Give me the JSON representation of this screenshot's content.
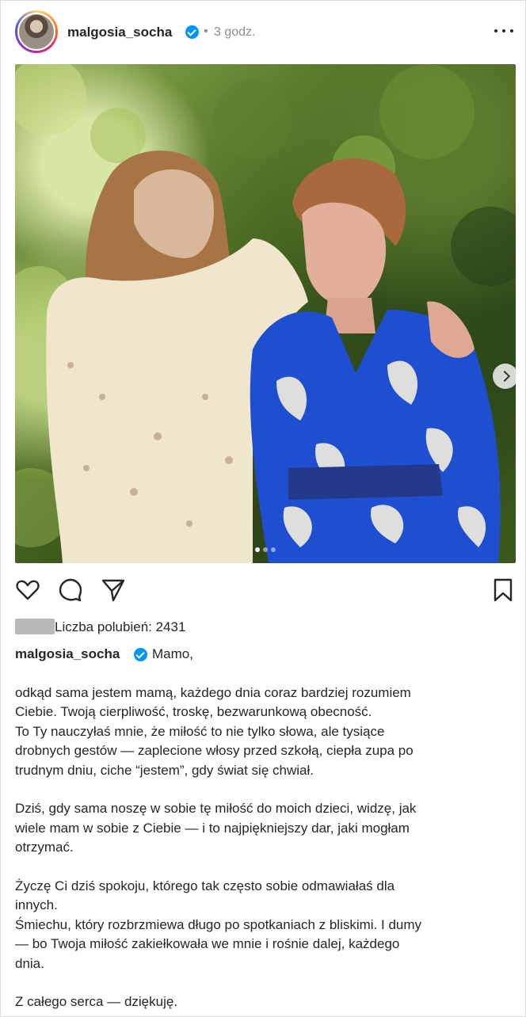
{
  "post": {
    "username": "malgosia_socha",
    "time": "3 godz.",
    "separator": "•",
    "likes_text": "Liczba polubień: 2431",
    "caption_first": "Mamo,",
    "caption_paragraphs": [
      [
        "odkąd sama jestem mamą, każdego dnia coraz bardziej rozumiem",
        "Ciebie. Twoją cierpliwość, troskę, bezwarunkową obecność.",
        "To Ty nauczyłaś mnie, że miłość to nie tylko słowa, ale tysiące",
        "drobnych gestów — zaplecione włosy przed szkołą, ciepła zupa po",
        "trudnym dniu, ciche “jestem”, gdy świat się chwiał."
      ],
      [
        "Dziś, gdy sama noszę w sobie tę miłość do moich dzieci, widzę, jak",
        "wiele mam w sobie z Ciebie — i to najpiękniejszy dar, jaki mogłam",
        "otrzymać."
      ],
      [
        "Życzę Ci dziś spokoju, którego tak często sobie odmawiałaś dla",
        "innych.",
        "Śmiechu, który rozbrzmiewa długo po spotkaniach z bliskimi. I dumy",
        "— bo Twoja miłość zakiełkowała we mnie i rośnie dalej, każdego",
        "dnia."
      ],
      [
        "Z całego serca — dziękuję."
      ]
    ]
  },
  "carousel": {
    "count": 3,
    "active_index": 0
  },
  "icons": {
    "avatar": "profile-photo",
    "verified": "verified-badge-icon",
    "more": "more-options-icon",
    "like": "heart-icon",
    "comment": "comment-icon",
    "share": "share-icon",
    "save": "bookmark-icon",
    "next": "chevron-right-icon"
  },
  "colors": {
    "verified": "#0095f6",
    "text": "#262626",
    "muted": "#8e8e8e",
    "dress_blue": "#1f4fd1",
    "dress_cream": "#efe6cc"
  }
}
